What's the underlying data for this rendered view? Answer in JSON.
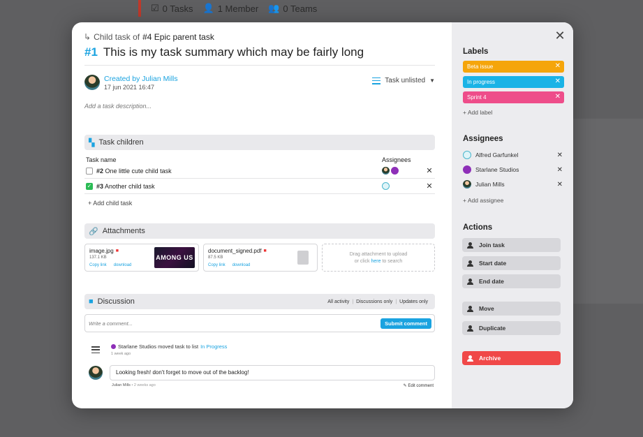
{
  "background": {
    "tasks": "0 Tasks",
    "members": "1 Member",
    "teams": "0 Teams"
  },
  "task": {
    "parent_prefix": "Child task of",
    "parent_ref": "#4 Epic parent task",
    "id": "#1",
    "title": "This is my task summary which may be fairly long",
    "created_by": "Created by Julian Mills",
    "created_at": "17 jun 2021 16:47",
    "list_status": "Task unlisted",
    "description_placeholder": "Add a task description..."
  },
  "children": {
    "heading": "Task children",
    "col_name": "Task name",
    "col_assignees": "Assignees",
    "rows": [
      {
        "id": "#2",
        "name": "One little cute child task",
        "done": false
      },
      {
        "id": "#3",
        "name": "Another child task",
        "done": true
      }
    ],
    "add": "+ Add child task"
  },
  "attachments": {
    "heading": "Attachments",
    "files": [
      {
        "name": "image.jpg",
        "size": "137.1 KB",
        "copy": "Copy link",
        "download": "download",
        "thumb_text": "AMONG US"
      },
      {
        "name": "document_signed.pdf",
        "size": "87.5 KB",
        "copy": "Copy link",
        "download": "download"
      }
    ],
    "drop_line1": "Drag attachment to upload",
    "drop_or": "or click",
    "drop_here": "here",
    "drop_tail": "to search"
  },
  "discussion": {
    "heading": "Discussion",
    "filters": [
      "All activity",
      "Discussions only",
      "Updates only"
    ],
    "comment_placeholder": "Write a comment...",
    "submit": "Submit comment",
    "activity_text": "Starlane Studios moved task to list",
    "activity_link": "In Progress",
    "activity_time": "1 week ago",
    "comment_text": "Looking fresh! don't forget to move out of the backlog!",
    "comment_author": "Julian Mills",
    "comment_time": "• 2 weeks ago",
    "edit": "Edit comment"
  },
  "sidebar": {
    "labels_heading": "Labels",
    "labels": [
      {
        "text": "Beta issue",
        "color": "#f5a50b"
      },
      {
        "text": "In progress",
        "color": "#1ab3e6"
      },
      {
        "text": "Sprint 4",
        "color": "#ee4d8a"
      }
    ],
    "add_label": "+ Add label",
    "assignees_heading": "Assignees",
    "assignees": [
      {
        "name": "Alfred Garfunkel"
      },
      {
        "name": "Starlane Studios"
      },
      {
        "name": "Julian Mills"
      }
    ],
    "add_assignee": "+ Add assignee",
    "actions_heading": "Actions",
    "actions": [
      "Join task",
      "Start date",
      "End date",
      "Move",
      "Duplicate",
      "Archive"
    ]
  },
  "colors": {
    "accent": "#1aa3e0",
    "danger": "#f04848",
    "success": "#2bbb55"
  }
}
